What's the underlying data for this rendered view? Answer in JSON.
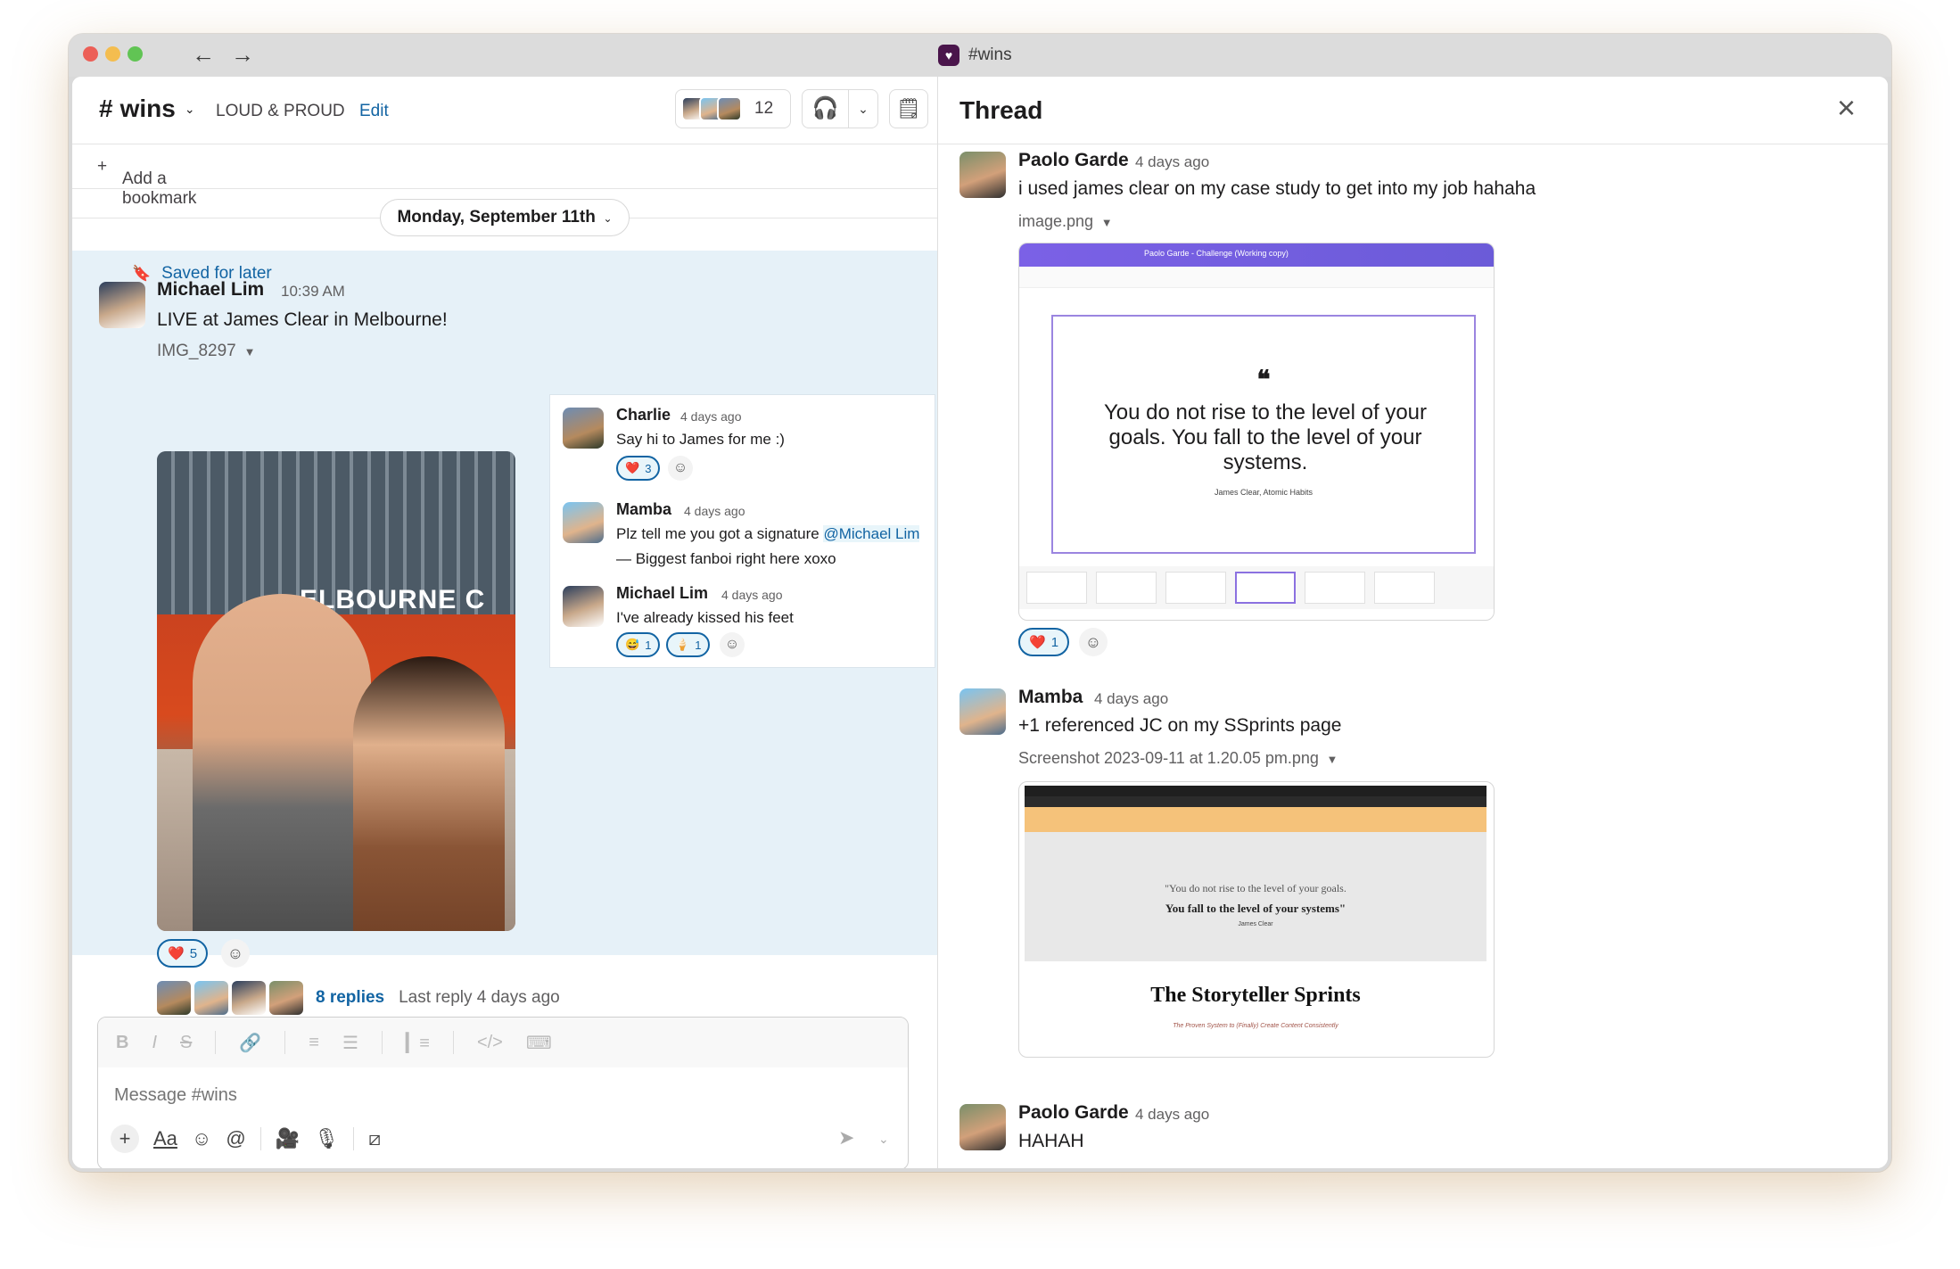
{
  "window": {
    "title": "#wins"
  },
  "channel": {
    "name": "wins",
    "topic": "LOUD & PROUD",
    "edit_label": "Edit",
    "member_count": "12",
    "bookmark_label": "Add a bookmark"
  },
  "date_divider": "Monday, September 11th",
  "saved_label": "Saved for later",
  "main_message": {
    "author": "Michael Lim",
    "time": "10:39 AM",
    "text": "LIVE at James Clear in Melbourne!",
    "file": "IMG_8297",
    "photo_sign": "ELBOURNE C",
    "reaction_heart_count": "5",
    "replies_label": "8 replies",
    "last_reply": "Last reply 4 days ago"
  },
  "thread_replies": [
    {
      "author": "Charlie",
      "time": "4 days ago",
      "text": "Say hi to James for me :)",
      "reaction_count": "3"
    },
    {
      "author": "Mamba",
      "time": "4 days ago",
      "text_before": "Plz tell me you got a signature",
      "mention": "@Michael Lim",
      "text_after": "— Biggest fanboi right here xoxo"
    },
    {
      "author": "Michael Lim",
      "time": "4 days ago",
      "text": "I've already kissed his feet",
      "reaction1_count": "1",
      "reaction2_count": "1"
    }
  ],
  "composer": {
    "placeholder": "Message #wins"
  },
  "thread_panel": {
    "title": "Thread",
    "messages": [
      {
        "author": "Paolo Garde",
        "time": "4 days ago",
        "text": "i used james clear on my case study to get into my job hahaha",
        "file": "image.png",
        "reaction_count": "1",
        "slide_header": "Paolo Garde - Challenge (Working copy)",
        "slide_quote": "You do not rise to the level of your goals. You fall to the level of your systems.",
        "slide_source": "James Clear, Atomic Habits"
      },
      {
        "author": "Mamba",
        "time": "4 days ago",
        "text": "+1 referenced JC on my SSprints page",
        "file": "Screenshot 2023-09-11 at 1.20.05 pm.png",
        "shot_quote1": "\"You do not rise to the level of your goals.",
        "shot_quote2": "You fall to the level of your systems\"",
        "shot_source": "James Clear",
        "shot_heading": "The Storyteller Sprints",
        "shot_sub": "The Proven System to (Finally) Create Content Consistently"
      },
      {
        "author": "Paolo Garde",
        "time": "4 days ago",
        "text": "HAHAH"
      }
    ]
  }
}
